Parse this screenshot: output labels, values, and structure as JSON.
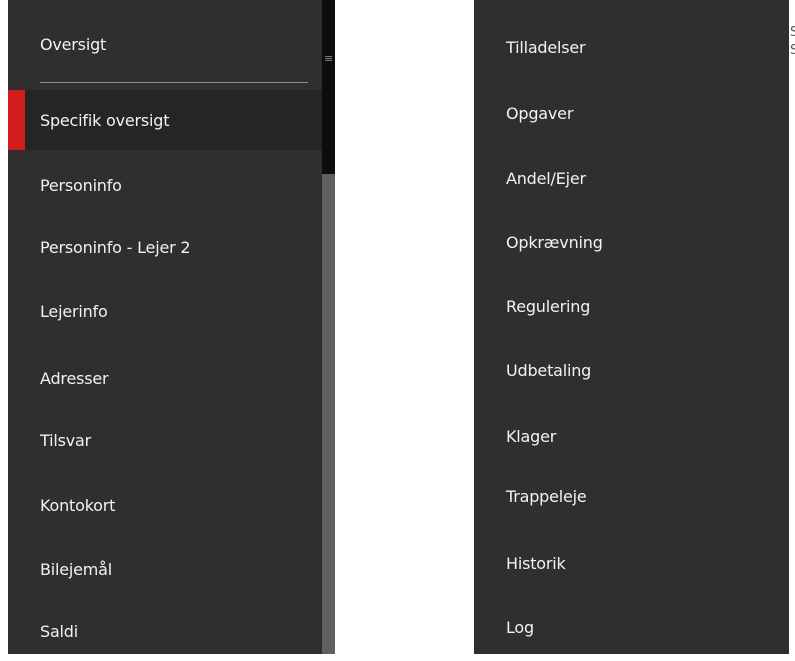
{
  "left_menu": {
    "items": [
      {
        "label": "Oversigt"
      },
      {
        "label": "Specifik oversigt"
      },
      {
        "label": "Personinfo"
      },
      {
        "label": "Personinfo - Lejer 2"
      },
      {
        "label": "Lejerinfo"
      },
      {
        "label": "Adresser"
      },
      {
        "label": "Tilsvar"
      },
      {
        "label": "Kontokort"
      },
      {
        "label": "Bilejemål"
      },
      {
        "label": "Saldi"
      }
    ],
    "active_index": 1
  },
  "right_menu": {
    "items": [
      {
        "label": "Tilladelser"
      },
      {
        "label": "Opgaver"
      },
      {
        "label": "Andel/Ejer"
      },
      {
        "label": "Opkrævning"
      },
      {
        "label": "Regulering"
      },
      {
        "label": "Udbetaling"
      },
      {
        "label": "Klager"
      },
      {
        "label": "Trappeleje"
      },
      {
        "label": "Historik"
      },
      {
        "label": "Log"
      }
    ]
  },
  "header": {
    "menu_icon": "hamburger-icon"
  },
  "edge_text": {
    "line1": "S",
    "line2": "S"
  },
  "colors": {
    "menu_bg": "#2f2f2f",
    "active_bg": "#252525",
    "active_marker": "#d11d1d",
    "text": "#f2f2f2"
  }
}
